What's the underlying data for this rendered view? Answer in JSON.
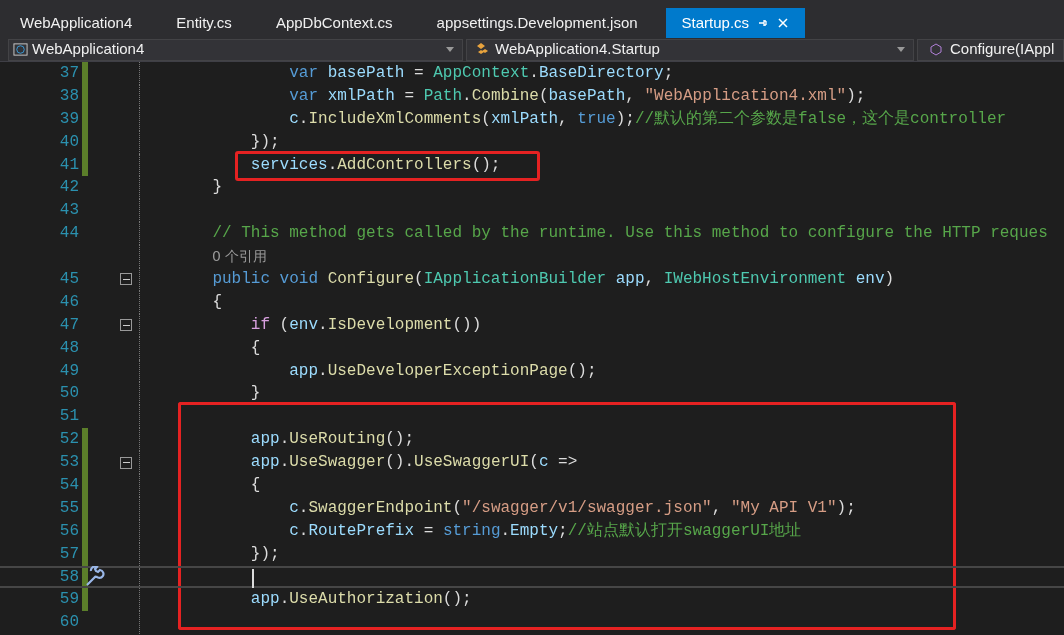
{
  "tabs": [
    {
      "label": "WebApplication4",
      "selected": false
    },
    {
      "label": "Entity.cs",
      "selected": false
    },
    {
      "label": "AppDbContext.cs",
      "selected": false
    },
    {
      "label": "appsettings.Development.json",
      "selected": false
    },
    {
      "label": "Startup.cs",
      "selected": true
    }
  ],
  "nav_bar": {
    "project": "WebApplication4",
    "class": "WebApplication4.Startup",
    "member": "Configure(IAppl"
  },
  "editor": {
    "lines": [
      {
        "kind": "code",
        "number": "37",
        "changed": true,
        "fold": false,
        "current": false,
        "framed": false,
        "tokens": [
          {
            "t": "            var",
            "kind": "keyword"
          },
          {
            "t": " basePath",
            "kind": "variable"
          },
          {
            "t": " = ",
            "kind": "plain"
          },
          {
            "t": "AppContext",
            "kind": "type"
          },
          {
            "t": ".",
            "kind": "plain"
          },
          {
            "t": "BaseDirectory",
            "kind": "variable"
          },
          {
            "t": ";",
            "kind": "plain"
          }
        ]
      },
      {
        "kind": "code",
        "number": "38",
        "changed": true,
        "fold": false,
        "current": false,
        "framed": false,
        "tokens": [
          {
            "t": "            var",
            "kind": "keyword"
          },
          {
            "t": " xmlPath",
            "kind": "variable"
          },
          {
            "t": " = ",
            "kind": "plain"
          },
          {
            "t": "Path",
            "kind": "type"
          },
          {
            "t": ".",
            "kind": "plain"
          },
          {
            "t": "Combine",
            "kind": "method"
          },
          {
            "t": "(",
            "kind": "plain"
          },
          {
            "t": "basePath",
            "kind": "variable"
          },
          {
            "t": ", ",
            "kind": "plain"
          },
          {
            "t": "\"WebApplication4.xml\"",
            "kind": "string"
          },
          {
            "t": ");",
            "kind": "plain"
          }
        ]
      },
      {
        "kind": "code",
        "number": "39",
        "changed": true,
        "fold": false,
        "current": false,
        "framed": false,
        "tokens": [
          {
            "t": "            c",
            "kind": "variable"
          },
          {
            "t": ".",
            "kind": "plain"
          },
          {
            "t": "IncludeXmlComments",
            "kind": "method"
          },
          {
            "t": "(",
            "kind": "plain"
          },
          {
            "t": "xmlPath",
            "kind": "variable"
          },
          {
            "t": ", ",
            "kind": "plain"
          },
          {
            "t": "true",
            "kind": "keyword"
          },
          {
            "t": ");",
            "kind": "plain"
          },
          {
            "t": "//默认的第二个参数是false，这个是controller",
            "kind": "comment"
          }
        ]
      },
      {
        "kind": "code",
        "number": "40",
        "changed": true,
        "fold": false,
        "current": false,
        "framed": false,
        "tokens": [
          {
            "t": "        });",
            "kind": "plain"
          }
        ]
      },
      {
        "kind": "code",
        "number": "41",
        "changed": true,
        "fold": false,
        "current": false,
        "framed": true,
        "tokens": [
          {
            "t": "        services",
            "kind": "variable"
          },
          {
            "t": ".",
            "kind": "plain"
          },
          {
            "t": "AddControllers",
            "kind": "method"
          },
          {
            "t": "();",
            "kind": "plain"
          }
        ]
      },
      {
        "kind": "code",
        "number": "42",
        "changed": false,
        "fold": false,
        "current": false,
        "framed": false,
        "tokens": [
          {
            "t": "    }",
            "kind": "plain"
          }
        ]
      },
      {
        "kind": "code",
        "number": "43",
        "changed": false,
        "fold": false,
        "current": false,
        "framed": false
      },
      {
        "kind": "code",
        "number": "44",
        "changed": false,
        "fold": false,
        "current": false,
        "framed": false,
        "tokens": [
          {
            "t": "    // This method gets called by the runtime. Use this method to configure the HTTP reques",
            "kind": "comment"
          }
        ]
      },
      {
        "kind": "codelens",
        "text": "0 个引用"
      },
      {
        "kind": "code",
        "number": "45",
        "changed": false,
        "fold": true,
        "current": false,
        "framed": false,
        "tokens": [
          {
            "t": "    public",
            "kind": "keyword"
          },
          {
            "t": " void",
            "kind": "keyword"
          },
          {
            "t": " Configure",
            "kind": "method"
          },
          {
            "t": "(",
            "kind": "plain"
          },
          {
            "t": "IApplicationBuilder",
            "kind": "type"
          },
          {
            "t": " app",
            "kind": "variable"
          },
          {
            "t": ", ",
            "kind": "plain"
          },
          {
            "t": "IWebHostEnvironment",
            "kind": "type"
          },
          {
            "t": " env",
            "kind": "variable"
          },
          {
            "t": ")",
            "kind": "plain"
          }
        ]
      },
      {
        "kind": "code",
        "number": "46",
        "changed": false,
        "fold": false,
        "current": false,
        "framed": false,
        "tokens": [
          {
            "t": "    {",
            "kind": "plain"
          }
        ]
      },
      {
        "kind": "code",
        "number": "47",
        "changed": false,
        "fold": true,
        "current": false,
        "framed": false,
        "tokens": [
          {
            "t": "        if",
            "kind": "control"
          },
          {
            "t": " (",
            "kind": "plain"
          },
          {
            "t": "env",
            "kind": "variable"
          },
          {
            "t": ".",
            "kind": "plain"
          },
          {
            "t": "IsDevelopment",
            "kind": "method"
          },
          {
            "t": "())",
            "kind": "plain"
          }
        ]
      },
      {
        "kind": "code",
        "number": "48",
        "changed": false,
        "fold": false,
        "current": false,
        "framed": false,
        "tokens": [
          {
            "t": "        {",
            "kind": "plain"
          }
        ]
      },
      {
        "kind": "code",
        "number": "49",
        "changed": false,
        "fold": false,
        "current": false,
        "framed": false,
        "tokens": [
          {
            "t": "            app",
            "kind": "variable"
          },
          {
            "t": ".",
            "kind": "plain"
          },
          {
            "t": "UseDeveloperExceptionPage",
            "kind": "method"
          },
          {
            "t": "();",
            "kind": "plain"
          }
        ]
      },
      {
        "kind": "code",
        "number": "50",
        "changed": false,
        "fold": false,
        "current": false,
        "framed": false,
        "tokens": [
          {
            "t": "        }",
            "kind": "plain"
          }
        ]
      },
      {
        "kind": "code",
        "number": "51",
        "changed": false,
        "fold": false,
        "current": false,
        "framed": true
      },
      {
        "kind": "code",
        "number": "52",
        "changed": true,
        "fold": false,
        "current": false,
        "framed": true,
        "tokens": [
          {
            "t": "        app",
            "kind": "variable"
          },
          {
            "t": ".",
            "kind": "plain"
          },
          {
            "t": "UseRouting",
            "kind": "method"
          },
          {
            "t": "();",
            "kind": "plain"
          }
        ]
      },
      {
        "kind": "code",
        "number": "53",
        "changed": true,
        "fold": true,
        "current": false,
        "framed": true,
        "tokens": [
          {
            "t": "        app",
            "kind": "variable"
          },
          {
            "t": ".",
            "kind": "plain"
          },
          {
            "t": "UseSwagger",
            "kind": "method"
          },
          {
            "t": "().",
            "kind": "plain"
          },
          {
            "t": "UseSwaggerUI",
            "kind": "method"
          },
          {
            "t": "(",
            "kind": "plain"
          },
          {
            "t": "c",
            "kind": "variable"
          },
          {
            "t": " =>",
            "kind": "plain"
          }
        ]
      },
      {
        "kind": "code",
        "number": "54",
        "changed": true,
        "fold": false,
        "current": false,
        "framed": true,
        "tokens": [
          {
            "t": "        {",
            "kind": "plain"
          }
        ]
      },
      {
        "kind": "code",
        "number": "55",
        "changed": true,
        "fold": false,
        "current": false,
        "framed": true,
        "tokens": [
          {
            "t": "            c",
            "kind": "variable"
          },
          {
            "t": ".",
            "kind": "plain"
          },
          {
            "t": "SwaggerEndpoint",
            "kind": "method"
          },
          {
            "t": "(",
            "kind": "plain"
          },
          {
            "t": "\"/swagger/v1/swagger.json\"",
            "kind": "string"
          },
          {
            "t": ", ",
            "kind": "plain"
          },
          {
            "t": "\"My API V1\"",
            "kind": "string"
          },
          {
            "t": ");",
            "kind": "plain"
          }
        ]
      },
      {
        "kind": "code",
        "number": "56",
        "changed": true,
        "fold": false,
        "current": false,
        "framed": true,
        "tokens": [
          {
            "t": "            c",
            "kind": "variable"
          },
          {
            "t": ".",
            "kind": "plain"
          },
          {
            "t": "RoutePrefix",
            "kind": "variable"
          },
          {
            "t": " = ",
            "kind": "plain"
          },
          {
            "t": "string",
            "kind": "keyword"
          },
          {
            "t": ".",
            "kind": "plain"
          },
          {
            "t": "Empty",
            "kind": "variable"
          },
          {
            "t": ";",
            "kind": "plain"
          },
          {
            "t": "//站点默认打开swaggerUI地址",
            "kind": "comment"
          }
        ]
      },
      {
        "kind": "code",
        "number": "57",
        "changed": true,
        "fold": false,
        "current": false,
        "framed": true,
        "tokens": [
          {
            "t": "        });",
            "kind": "plain"
          }
        ]
      },
      {
        "kind": "code",
        "number": "58",
        "changed": true,
        "fold": false,
        "current": true,
        "framed": true
      },
      {
        "kind": "code",
        "number": "59",
        "changed": true,
        "fold": false,
        "current": false,
        "framed": true,
        "tokens": [
          {
            "t": "        app",
            "kind": "variable"
          },
          {
            "t": ".",
            "kind": "plain"
          },
          {
            "t": "UseAuthorization",
            "kind": "method"
          },
          {
            "t": "();",
            "kind": "plain"
          }
        ]
      },
      {
        "kind": "code",
        "number": "60",
        "changed": false,
        "fold": false,
        "current": false,
        "framed": true
      }
    ]
  }
}
